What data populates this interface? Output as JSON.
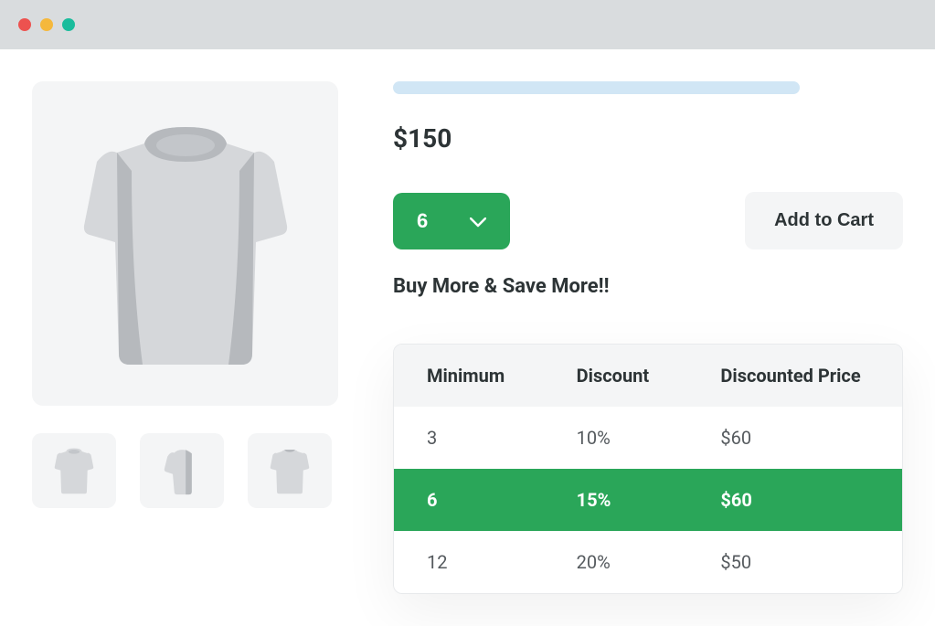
{
  "product": {
    "price": "$150",
    "selected_qty": "6",
    "add_to_cart_label": "Add to Cart",
    "promo_text": "Buy More & Save More!!"
  },
  "discount_table": {
    "headers": {
      "minimum": "Minimum",
      "discount": "Discount",
      "price": "Discounted Price"
    },
    "rows": [
      {
        "minimum": "3",
        "discount": "10%",
        "price": "$60",
        "active": false
      },
      {
        "minimum": "6",
        "discount": "15%",
        "price": "$60",
        "active": true
      },
      {
        "minimum": "12",
        "discount": "20%",
        "price": "$50",
        "active": false
      }
    ]
  }
}
